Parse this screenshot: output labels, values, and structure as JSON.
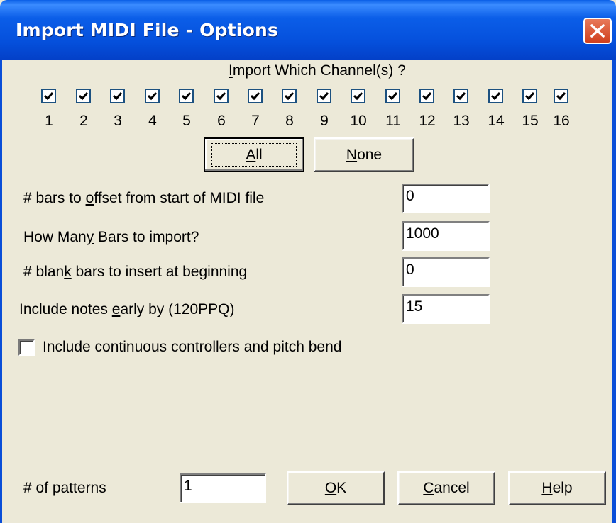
{
  "window": {
    "title": "Import MIDI File - Options"
  },
  "channels": {
    "heading_pre": "",
    "heading_accel": "I",
    "heading_post": "mport Which Channel(s) ?",
    "items": [
      {
        "label": "1",
        "checked": true
      },
      {
        "label": "2",
        "checked": true
      },
      {
        "label": "3",
        "checked": true
      },
      {
        "label": "4",
        "checked": true
      },
      {
        "label": "5",
        "checked": true
      },
      {
        "label": "6",
        "checked": true
      },
      {
        "label": "7",
        "checked": true
      },
      {
        "label": "8",
        "checked": true
      },
      {
        "label": "9",
        "checked": true
      },
      {
        "label": "10",
        "checked": true
      },
      {
        "label": "11",
        "checked": true
      },
      {
        "label": "12",
        "checked": true
      },
      {
        "label": "13",
        "checked": true
      },
      {
        "label": "14",
        "checked": true
      },
      {
        "label": "15",
        "checked": true
      },
      {
        "label": "16",
        "checked": true
      }
    ],
    "all_button": {
      "pre": "",
      "accel": "A",
      "post": "ll"
    },
    "none_button": {
      "pre": "",
      "accel": "N",
      "post": "one"
    }
  },
  "fields": {
    "offset": {
      "pre": "# bars to ",
      "accel": "o",
      "post": "ffset from start of MIDI file",
      "value": "0"
    },
    "count": {
      "pre": "How Man",
      "accel": "y",
      "post": " Bars to import?",
      "value": "1000"
    },
    "blank": {
      "pre": "# blan",
      "accel": "k",
      "post": " bars to insert at beginning",
      "value": "0"
    },
    "early": {
      "pre": "Include notes ",
      "accel": "e",
      "post": "arly by (120PPQ)",
      "value": "15"
    }
  },
  "controllers": {
    "label": "Include continuous controllers and pitch bend",
    "checked": false
  },
  "patterns": {
    "label": "# of patterns",
    "value": "1"
  },
  "buttons": {
    "ok": {
      "pre": "",
      "accel": "O",
      "post": "K"
    },
    "cancel": {
      "pre": "",
      "accel": "C",
      "post": "ancel"
    },
    "help": {
      "pre": "",
      "accel": "H",
      "post": "elp"
    }
  },
  "icons": {
    "close": "close-icon",
    "check": "checkmark-icon"
  },
  "colors": {
    "title_bar": "#0550DC",
    "close_button": "#D0401E",
    "dialog_face": "#ECE9D8"
  }
}
